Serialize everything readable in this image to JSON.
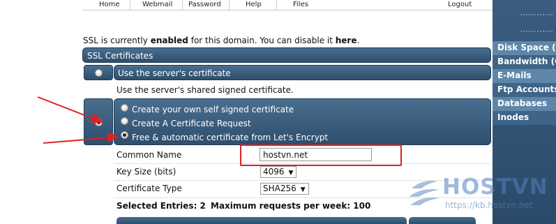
{
  "nav": {
    "items": [
      "Home",
      "Webmail",
      "Password",
      "Help",
      "Files",
      "Logout"
    ]
  },
  "status": {
    "prefix": "SSL is currently ",
    "state": "enabled",
    "middle": " for this domain. You can disable it ",
    "link": "here",
    "suffix": "."
  },
  "ssl_section": {
    "header": "SSL Certificates",
    "option_server": "Use the server's certificate",
    "option_server_desc": "Use the server's shared signed certificate.",
    "sub_options": [
      "Create your own self signed certificate",
      "Create A Certificate Request",
      "Free & automatic certificate from Let's Encrypt"
    ],
    "selected_sub_option": 2
  },
  "form": {
    "common_name_label": "Common Name",
    "common_name_value": "hostvn.net",
    "key_size_label": "Key Size (bits)",
    "key_size_value": "4096",
    "cert_type_label": "Certificate Type",
    "cert_type_value": "SHA256",
    "entries_info": "Selected Entries: 2",
    "max_requests": "Maximum requests per week: 100"
  },
  "sidebar": {
    "items": [
      "Disk Space (MB)",
      "Bandwidth (GB)",
      "E-Mails",
      "Ftp Accounts",
      "Databases",
      "Inodes"
    ]
  },
  "watermark": {
    "brand": "HOSTVN",
    "url": "https://kb.hostvn.net"
  },
  "colors": {
    "bar": "#2e4f6d",
    "sidebar": "#3a5d80",
    "annotation": "#e02020",
    "watermark": "#5082be"
  }
}
